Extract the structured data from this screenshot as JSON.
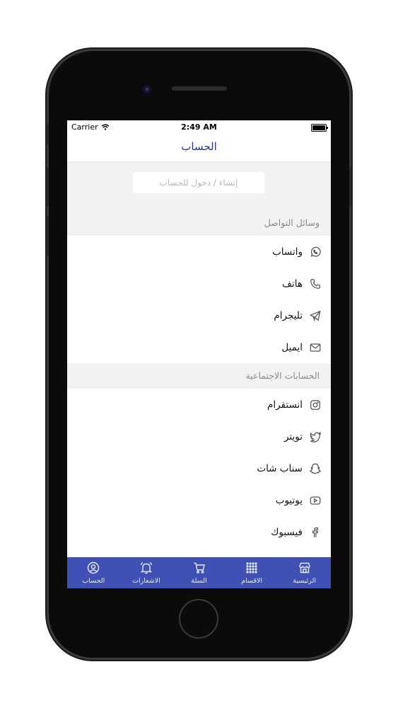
{
  "status_bar": {
    "carrier": "Carrier",
    "time": "2:49 AM"
  },
  "nav": {
    "title": "الحساب"
  },
  "login": {
    "label": "إنشاء / دخول للحساب"
  },
  "sections": [
    {
      "header": "وسائل التواصل",
      "items": [
        {
          "label": "واتساب",
          "icon": "whatsapp-icon"
        },
        {
          "label": "هاتف",
          "icon": "phone-icon"
        },
        {
          "label": "تليجرام",
          "icon": "telegram-icon"
        },
        {
          "label": "ايميل",
          "icon": "mail-icon"
        }
      ]
    },
    {
      "header": "الحسابات الاجتماعية",
      "items": [
        {
          "label": "انستقرام",
          "icon": "instagram-icon"
        },
        {
          "label": "تويتر",
          "icon": "twitter-icon"
        },
        {
          "label": "سناب شات",
          "icon": "snapchat-icon"
        },
        {
          "label": "يوتيوب",
          "icon": "youtube-icon"
        },
        {
          "label": "فيسبوك",
          "icon": "facebook-icon"
        }
      ]
    }
  ],
  "tabs": [
    {
      "label": "الرئيسية",
      "icon": "store-icon"
    },
    {
      "label": "الاقسام",
      "icon": "grid-icon"
    },
    {
      "label": "السلة",
      "icon": "cart-icon"
    },
    {
      "label": "الاشعارات",
      "icon": "bell-icon"
    },
    {
      "label": "الحساب",
      "icon": "user-icon"
    }
  ],
  "colors": {
    "accent": "#3f51b5",
    "title": "#283593",
    "section_bg": "#f2f2f4"
  }
}
